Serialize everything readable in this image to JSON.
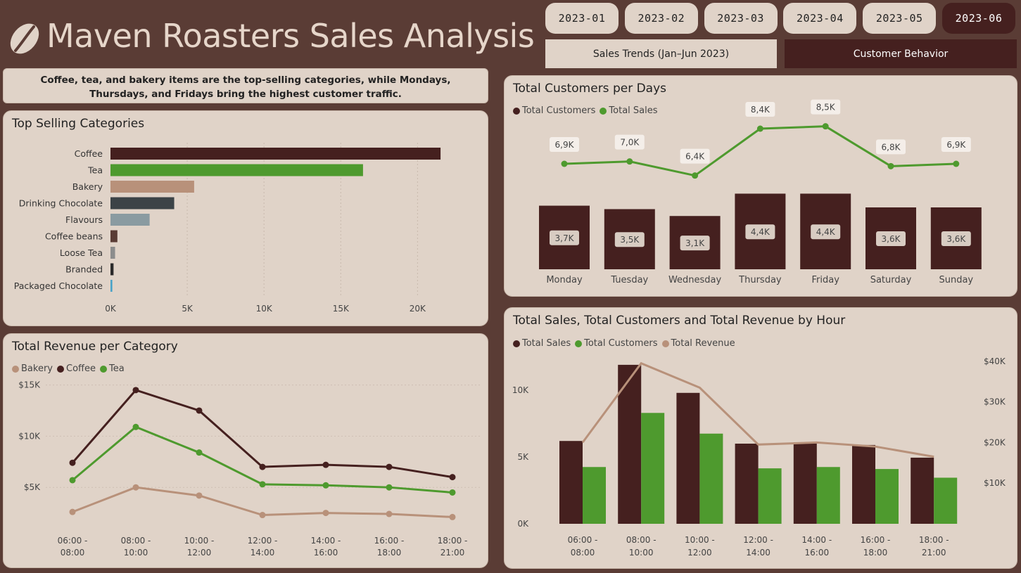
{
  "header": {
    "title": "Maven Roasters Sales Analysis",
    "logo_icon": "coffee-bean-icon"
  },
  "months": [
    {
      "label": "2023-01",
      "active": false
    },
    {
      "label": "2023-02",
      "active": false
    },
    {
      "label": "2023-03",
      "active": false
    },
    {
      "label": "2023-04",
      "active": false
    },
    {
      "label": "2023-05",
      "active": false
    },
    {
      "label": "2023-06",
      "active": true
    }
  ],
  "tabs": {
    "sales_trends": "Sales Trends (Jan–Jun 2023)",
    "customer_behavior": "Customer Behavior"
  },
  "insight": {
    "line1": "Coffee, tea, and bakery items are the top-selling categories, while Mondays,",
    "line2": "Thursdays, and Fridays bring the highest customer traffic."
  },
  "colors": {
    "dark_brown": "#45201f",
    "green": "#4e9a2e",
    "tan": "#b8917a",
    "slate": "#3c4347",
    "bg": "#5a3c35",
    "panel": "#e0d3c8"
  },
  "chart_data": [
    {
      "id": "top_selling",
      "type": "bar",
      "orientation": "horizontal",
      "title": "Top Selling Categories",
      "categories": [
        "Coffee",
        "Tea",
        "Bakery",
        "Drinking Chocolate",
        "Flavours",
        "Coffee beans",
        "Loose Tea",
        "Branded",
        "Packaged Chocolate"
      ],
      "values": [
        21500,
        16450,
        5450,
        4150,
        2550,
        450,
        300,
        200,
        120
      ],
      "colors": [
        "#45201f",
        "#4e9a2e",
        "#b8917a",
        "#3c4347",
        "#8a9ba1",
        "#5a3c35",
        "#8c8c8c",
        "#2a2a2a",
        "#4aa3c8"
      ],
      "xlim": [
        0,
        22000
      ],
      "xticks": [
        {
          "v": 0,
          "label": "0K"
        },
        {
          "v": 5000,
          "label": "5K"
        },
        {
          "v": 10000,
          "label": "10K"
        },
        {
          "v": 15000,
          "label": "15K"
        },
        {
          "v": 20000,
          "label": "20K"
        }
      ],
      "grid": true
    },
    {
      "id": "revenue_per_category",
      "type": "line",
      "title": "Total Revenue per Category",
      "categories": [
        "06:00 - 08:00",
        "08:00 - 10:00",
        "10:00 - 12:00",
        "12:00 - 14:00",
        "14:00 - 16:00",
        "16:00 - 18:00",
        "18:00 - 21:00"
      ],
      "series": [
        {
          "name": "Bakery",
          "color": "#b8917a",
          "values": [
            2600,
            5000,
            4200,
            2300,
            2500,
            2400,
            2100
          ]
        },
        {
          "name": "Coffee",
          "color": "#45201f",
          "values": [
            7400,
            14500,
            12500,
            7000,
            7200,
            7000,
            6000
          ]
        },
        {
          "name": "Tea",
          "color": "#4e9a2e",
          "values": [
            5700,
            10900,
            8400,
            5300,
            5200,
            5000,
            4500
          ]
        }
      ],
      "ylim": [
        0,
        16000
      ],
      "yticks": [
        {
          "v": 5000,
          "label": "$5K"
        },
        {
          "v": 10000,
          "label": "$10K"
        },
        {
          "v": 15000,
          "label": "$15K"
        }
      ]
    },
    {
      "id": "customers_per_day",
      "type": "bar",
      "title": "Total Customers per Days",
      "categories": [
        "Monday",
        "Tuesday",
        "Wednesday",
        "Thursday",
        "Friday",
        "Saturday",
        "Sunday"
      ],
      "series": [
        {
          "name": "Total Customers",
          "color": "#45201f",
          "values": [
            3700,
            3500,
            3100,
            4400,
            4400,
            3600,
            3600
          ],
          "labels": [
            "3,7K",
            "3,5K",
            "3,1K",
            "4,4K",
            "4,4K",
            "3,6K",
            "3,6K"
          ]
        },
        {
          "name": "Total Sales",
          "color": "#4e9a2e",
          "type": "line",
          "values": [
            6900,
            7000,
            6400,
            8400,
            8500,
            6800,
            6900
          ],
          "labels": [
            "6,9K",
            "7,0K",
            "6,4K",
            "8,4K",
            "8,5K",
            "6,8K",
            "6,9K"
          ]
        }
      ]
    },
    {
      "id": "sales_by_hour",
      "type": "bar",
      "title": "Total Sales, Total Customers and Total Revenue by Hour",
      "categories": [
        "06:00 - 08:00",
        "08:00 - 10:00",
        "10:00 - 12:00",
        "12:00 - 14:00",
        "14:00 - 16:00",
        "16:00 - 18:00",
        "18:00 - 21:00"
      ],
      "series": [
        {
          "name": "Total Sales",
          "color": "#45201f",
          "values": [
            6200,
            11900,
            9800,
            6000,
            6100,
            5900,
            4950
          ]
        },
        {
          "name": "Total Customers",
          "color": "#4e9a2e",
          "values": [
            4250,
            8300,
            6750,
            4150,
            4250,
            4100,
            3450
          ]
        },
        {
          "name": "Total Revenue",
          "color": "#b8917a",
          "type": "line",
          "axis": "right",
          "values": [
            20000,
            39500,
            33500,
            19500,
            20000,
            19000,
            16500
          ]
        }
      ],
      "ylim_left": [
        0,
        12000
      ],
      "yticks_left": [
        {
          "v": 0,
          "label": "0K"
        },
        {
          "v": 5000,
          "label": "5K"
        },
        {
          "v": 10000,
          "label": "10K"
        }
      ],
      "ylim_right": [
        0,
        40000
      ],
      "yticks_right": [
        {
          "v": 10000,
          "label": "$10K"
        },
        {
          "v": 20000,
          "label": "$20K"
        },
        {
          "v": 30000,
          "label": "$30K"
        },
        {
          "v": 40000,
          "label": "$40K"
        }
      ]
    }
  ]
}
